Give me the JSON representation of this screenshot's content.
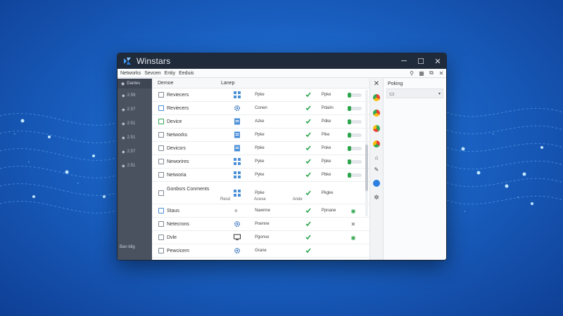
{
  "window": {
    "title": "Winstars",
    "controls": [
      "─",
      "☐",
      "✕"
    ]
  },
  "menu": {
    "items": [
      "Networks",
      "Sevcen",
      "Entiy",
      "Eeduis"
    ],
    "toolbar_icons": [
      "filter-icon",
      "grid-icon",
      "restore-icon",
      "close-icon"
    ]
  },
  "sidebar": {
    "header": "Dantes",
    "items": [
      "2.59",
      "2.57",
      "2.51",
      "2.51",
      "2.57",
      "2.51"
    ],
    "footer": "Ban ldig"
  },
  "table": {
    "headers": {
      "name": "Demoe",
      "type": "Lanep"
    },
    "rows": [
      {
        "name": "Reviecers",
        "col_a": "Ppke",
        "col_c": "Ppke",
        "cb": "normal",
        "type_icon": "grid",
        "status": "toggle"
      },
      {
        "name": "Reviecers",
        "col_a": "Conen",
        "col_c": "Pdaim",
        "cb": "blue",
        "type_icon": "gear",
        "status": "toggle"
      },
      {
        "name": "Device",
        "col_a": "Azke",
        "col_c": "Pdke",
        "cb": "green",
        "type_icon": "doc",
        "status": "toggle"
      },
      {
        "name": "Networks",
        "col_a": "Ppke",
        "col_c": "Pike",
        "cb": "normal",
        "type_icon": "doc",
        "status": "toggle"
      },
      {
        "name": "Devicsrs",
        "col_a": "Ppke",
        "col_c": "Poke",
        "cb": "normal",
        "type_icon": "doc",
        "status": "toggle"
      },
      {
        "name": "Neworires",
        "col_a": "Pyke",
        "col_c": "Ppke",
        "cb": "normal",
        "type_icon": "grid",
        "status": "toggle"
      },
      {
        "name": "Networia",
        "col_a": "Pyke",
        "col_c": "Pbke",
        "cb": "normal",
        "type_icon": "grid",
        "status": "toggle"
      },
      {
        "name": "Gonbsrs Conments",
        "col_a": "Ppke",
        "col_c": "Pkgke",
        "cb": "normal",
        "type_icon": "grid",
        "status": "none",
        "tall": true,
        "sub_a": "Resd",
        "sub_b": "Acese",
        "sub_c": "Ande"
      },
      {
        "name": "Staus",
        "col_a": "Nawnne",
        "col_c": "Ppnane",
        "cb": "blue",
        "type_icon": "stars",
        "status": "eye"
      },
      {
        "name": "Netecrons",
        "col_a": "Poenne",
        "col_c": "",
        "cb": "normal",
        "type_icon": "gear",
        "status": "x"
      },
      {
        "name": "Dvle",
        "col_a": "Pgonse",
        "col_c": "",
        "cb": "normal",
        "type_icon": "monitor",
        "status": "eye"
      },
      {
        "name": "Pewcicem",
        "col_a": "Grane",
        "col_c": "",
        "cb": "normal",
        "type_icon": "gear",
        "status": "none"
      }
    ]
  },
  "right_panel": {
    "header": "Poking",
    "select_value": ""
  },
  "colors": {
    "accent_green": "#2da44e",
    "accent_blue": "#4a8fd8",
    "titlebar": "#1f2a3b",
    "sidebar": "#4a5260"
  }
}
